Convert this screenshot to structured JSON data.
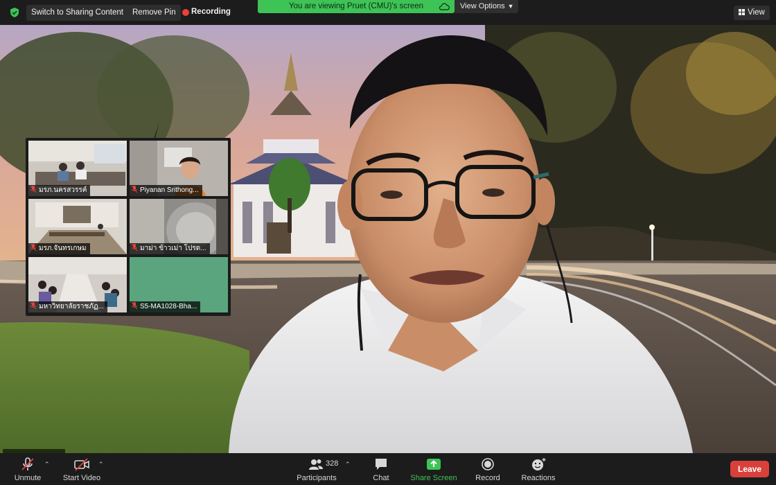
{
  "topbar": {
    "switch_label": "Switch to Sharing Content",
    "remove_pin_label": "Remove Pin",
    "recording_label": "Recording",
    "viewing_banner": "You are viewing Pruet (CMU)'s screen",
    "view_options_label": "View Options",
    "view_label": "View"
  },
  "gallery": {
    "tiles": [
      {
        "name": "มรภ.นครสวรรค์"
      },
      {
        "name": "Piyanan Srithong..."
      },
      {
        "name": "มรภ.จันทรเกษม"
      },
      {
        "name": "มาม่า ข้าวเม่า โปรด..."
      },
      {
        "name": "มหาวิทยาลัยราชภัฏ..."
      },
      {
        "name": "S5-MA1028-Bha..."
      }
    ]
  },
  "toolbar": {
    "unmute_label": "Unmute",
    "start_video_label": "Start Video",
    "participants_label": "Participants",
    "participants_count": "328",
    "chat_label": "Chat",
    "share_screen_label": "Share Screen",
    "record_label": "Record",
    "reactions_label": "Reactions",
    "leave_label": "Leave"
  },
  "colors": {
    "accent_green": "#3ec356",
    "recording_red": "#e8413a",
    "leave_red": "#d9403a",
    "bar_dark": "#1c1c1c"
  }
}
